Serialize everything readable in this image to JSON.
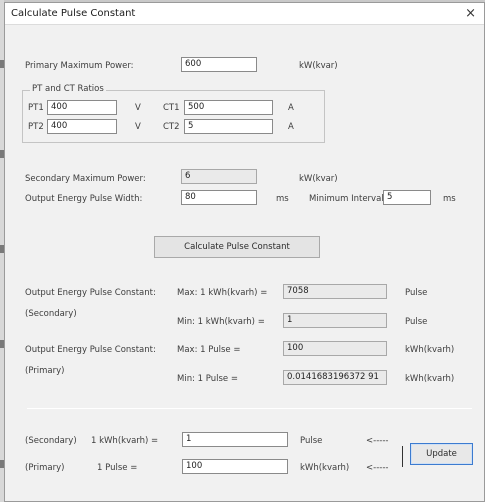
{
  "window": {
    "title": "Calculate Pulse Constant",
    "close_glyph": "×"
  },
  "primary_power": {
    "label": "Primary Maximum Power:",
    "value": "600",
    "unit": "kW(kvar)"
  },
  "ratios": {
    "legend": "PT and CT Ratios",
    "pt1": {
      "label": "PT1",
      "value": "400",
      "unit": "V"
    },
    "pt2": {
      "label": "PT2",
      "value": "400",
      "unit": "V"
    },
    "ct1": {
      "label": "CT1",
      "value": "500",
      "unit": "A"
    },
    "ct2": {
      "label": "CT2",
      "value": "5",
      "unit": "A"
    }
  },
  "secondary_power": {
    "label": "Secondary Maximum Power:",
    "value": "6",
    "unit": "kW(kvar)"
  },
  "pulse_width": {
    "label": "Output Energy Pulse Width:",
    "value": "80",
    "unit": "ms"
  },
  "min_interval": {
    "label": "Minimum Interval:",
    "value": "5",
    "unit": "ms"
  },
  "calc_button": {
    "label": "Calculate Pulse Constant"
  },
  "secondary_const": {
    "label1": "Output Energy Pulse Constant:",
    "label2": "(Secondary)",
    "max_label": "Max: 1 kWh(kvarh) =",
    "max_value": "7058",
    "max_unit": "Pulse",
    "min_label": "Min: 1 kWh(kvarh) =",
    "min_value": "1",
    "min_unit": "Pulse"
  },
  "primary_const": {
    "label1": "Output Energy Pulse Constant:",
    "label2": "(Primary)",
    "max_label": "Max: 1 Pulse =",
    "max_value": "100",
    "max_unit": "kWh(kvarh)",
    "min_label": "Min: 1 Pulse =",
    "min_value": "0.0141683196372 91",
    "min_unit": "kWh(kvarh)"
  },
  "update_section": {
    "secondary_label": "(Secondary)",
    "secondary_expr": "1 kWh(kvarh) =",
    "secondary_value": "1",
    "secondary_unit": "Pulse",
    "secondary_arrow": "<-----",
    "primary_label": "(Primary)",
    "primary_expr": "1 Pulse =",
    "primary_value": "100",
    "primary_unit": "kWh(kvarh)",
    "primary_arrow": "<-----",
    "update_label": "Update"
  }
}
